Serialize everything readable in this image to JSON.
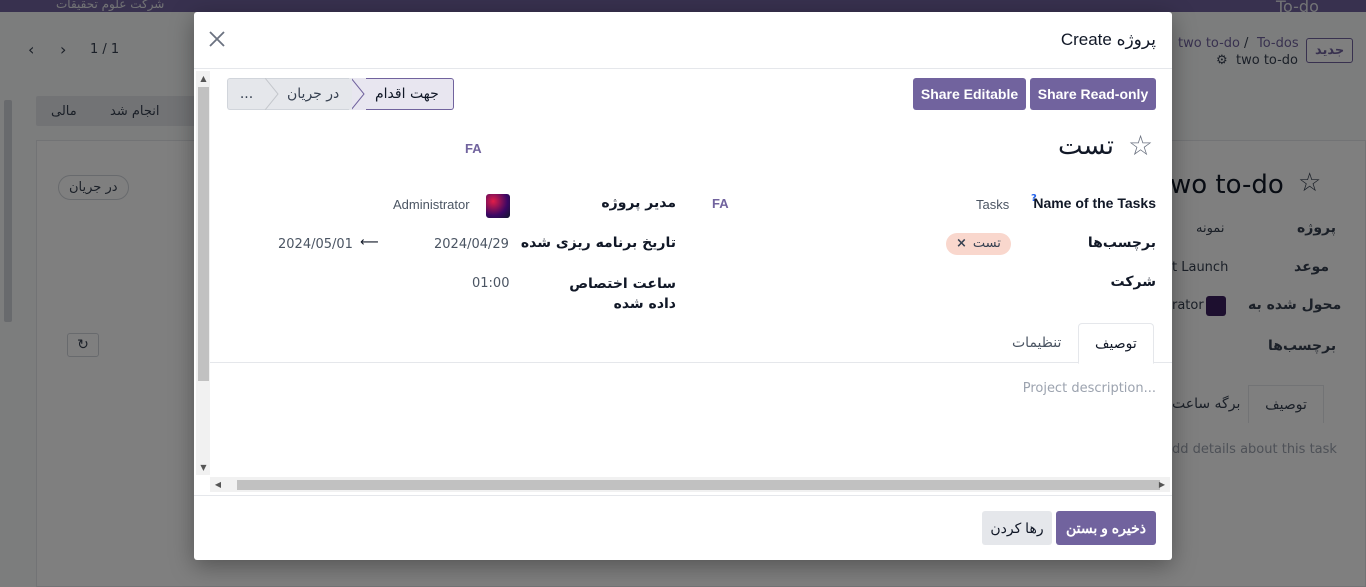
{
  "background": {
    "app_title": "To-do",
    "company_name": "شرکت علوم تحقیقات",
    "new_button": "جدید",
    "breadcrumb": {
      "root": "To-dos",
      "separator": "/",
      "current": "two to-do"
    },
    "record_name": "two to-do",
    "pager": "1 / 1",
    "stages": [
      "انجام شد",
      "مالی"
    ],
    "status_pill": "در جریان",
    "record_title": "wo to-do",
    "fields": [
      {
        "label": "پروژه",
        "value": "نمونه"
      },
      {
        "label": "موعد",
        "value": "t Launch"
      },
      {
        "label": "محول شده به",
        "value": "rator"
      },
      {
        "label": "برچسب‌ها",
        "value": ""
      }
    ],
    "tabs": [
      "توصیف",
      "برگه ساعت"
    ],
    "description_placeholder": "dd details about this task"
  },
  "modal": {
    "title": "Create پروژه",
    "close_label": "×",
    "share_readonly_label": "Share Read-only",
    "share_editable_label": "Share Editable",
    "stages": {
      "more": "...",
      "in_progress": "در جریان",
      "active": "جهت اقدام"
    },
    "project_name": "تست",
    "name_lang": "FA",
    "fields": {
      "name_of_tasks": {
        "label": "Name of the Tasks",
        "help": "?",
        "value": "Tasks",
        "lang": "FA"
      },
      "project_manager": {
        "label": "مدیر پروژه",
        "value": "Administrator"
      },
      "tags": {
        "label": "برچسب‌ها",
        "tag": "تست",
        "remove": "×"
      },
      "planned_date": {
        "label": "تاریخ برنامه ریزی شده",
        "start": "2024/04/29",
        "arrow": "⟵",
        "end": "2024/05/01"
      },
      "company": {
        "label": "شرکت",
        "value": ""
      },
      "allocated_hours": {
        "label": "ساعت اختصاص داده شده",
        "value": "01:00"
      }
    },
    "tabs": {
      "description": "توصیف",
      "settings": "تنظیمات"
    },
    "description_placeholder": "Project description...",
    "footer": {
      "save_close_label": "ذخیره و بستن",
      "discard_label": "رها کردن"
    },
    "colors": {
      "primary": "#71639e",
      "tag_bg": "#f9d7cd"
    }
  }
}
